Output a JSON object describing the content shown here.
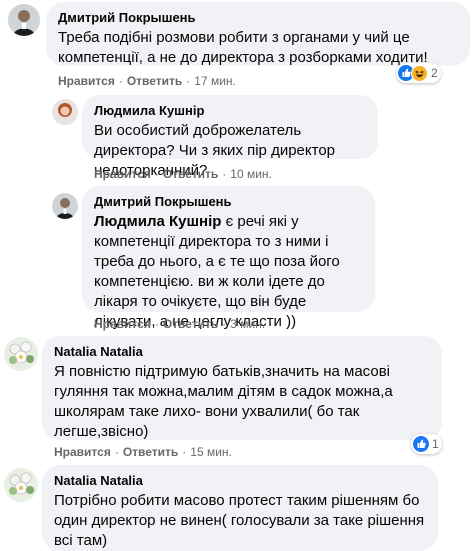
{
  "comments": [
    {
      "author": "Дмитрий Покрышень",
      "text": "Треба подібні розмови робити з органами у чий це компетенції, а не до директора з розборками ходити!",
      "like_label": "Нравится",
      "reply_label": "Ответить",
      "time": "17 мин.",
      "reaction_count": "2",
      "reactions": [
        "like-icon",
        "haha-icon"
      ]
    },
    {
      "author": "Людмила Кушнір",
      "text": "Ви особистий доброжелатель директора? Чи з яких пір директор недоторканний?",
      "like_label": "Нравится",
      "reply_label": "Ответить",
      "time": "10 мин."
    },
    {
      "author": "Дмитрий Покрышень",
      "mention": "Людмила Кушнір",
      "text": " є речі які у компетенції директора то з ними і треба до нього, а є те що поза його компетенцією. ви ж коли ідете до лікаря то очікуєте, що він буде лікувати, а не цеглу класти ))",
      "like_label": "Нравится",
      "reply_label": "Ответить",
      "time": "3 мин."
    },
    {
      "author": "Natalia Natalia",
      "text": "Я повністю підтримую батьків,значить на масові гуляння так можна,малим дітям в садок можна,а школярам таке лихо- вони ухвалили( бо так легше,звісно)",
      "like_label": "Нравится",
      "reply_label": "Ответить",
      "time": "15 мин.",
      "reaction_count": "1",
      "reactions": [
        "like-icon"
      ]
    },
    {
      "author": "Natalia Natalia",
      "text": "Потрібно робити масово протест таким рішенням бо один директор не винен( голосували за таке рішення всі там)"
    }
  ],
  "colors": {
    "bubble": "#f0f2f5",
    "meta": "#65676b",
    "like_blue": "#1877f2",
    "haha_yellow": "#f7b125"
  }
}
